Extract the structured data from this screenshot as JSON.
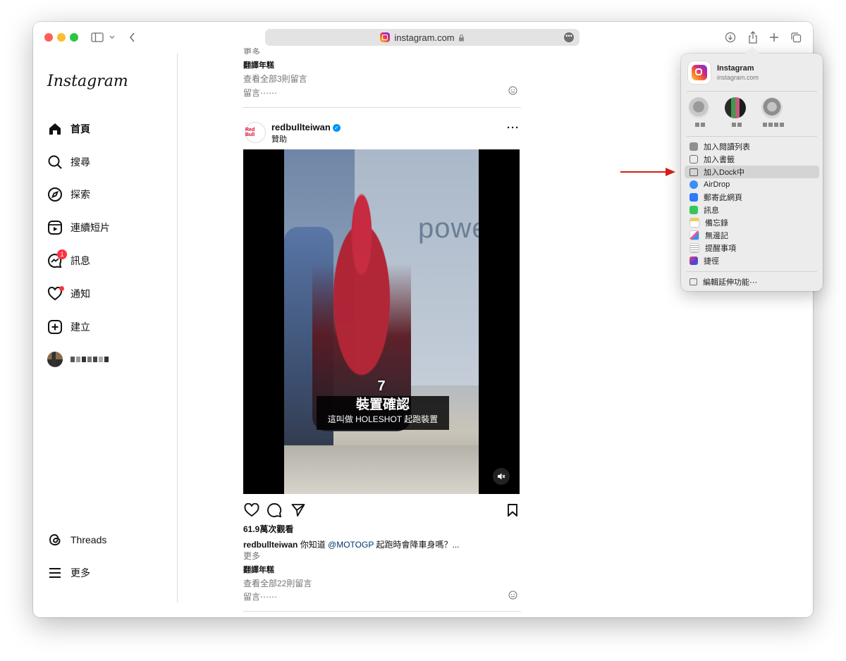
{
  "browser": {
    "url": "instagram.com"
  },
  "sidebar": {
    "logo": "Instagram",
    "items": [
      {
        "label": "首頁",
        "icon": "home-icon"
      },
      {
        "label": "搜尋",
        "icon": "search-icon"
      },
      {
        "label": "探索",
        "icon": "compass-icon"
      },
      {
        "label": "連續短片",
        "icon": "reels-icon"
      },
      {
        "label": "訊息",
        "icon": "messenger-icon",
        "badge": "1"
      },
      {
        "label": "通知",
        "icon": "heart-icon"
      },
      {
        "label": "建立",
        "icon": "plus-square-icon"
      },
      {
        "label": "Threads",
        "icon": "threads-icon"
      },
      {
        "label": "更多",
        "icon": "menu-icon"
      }
    ]
  },
  "feed": {
    "prev_post": {
      "more": "更多",
      "translate": "翻譯年糕",
      "view_comments": "查看全部3則留言",
      "comment_placeholder": "留言⋯⋯"
    },
    "post": {
      "username": "redbullteiwan",
      "sponsored": "贊助",
      "avatar_text": "Red Bull",
      "video_caption_number": "7",
      "video_caption_title": "裝置確認",
      "video_caption_sub": "這叫做 HOLESHOT 起跑裝置",
      "wall_text": "powe",
      "views": "61.9萬次觀看",
      "caption_user": "redbullteiwan",
      "caption_text_a": "你知道",
      "caption_mention": "@MOTOGP",
      "caption_text_b": "起跑時會降車身嗎？...",
      "more": "更多",
      "translate": "翻譯年糕",
      "view_comments": "查看全部22則留言",
      "comment_placeholder": "留言⋯⋯",
      "more_options": "···"
    }
  },
  "share_menu": {
    "app_name": "Instagram",
    "app_url": "instagram.com",
    "items": [
      {
        "label": "加入閱讀列表",
        "color": "#8e8e93"
      },
      {
        "label": "加入書籤",
        "color": "#8e8e93"
      },
      {
        "label": "加入Dock中",
        "color": "#6e6e73"
      },
      {
        "label": "AirDrop",
        "color": "#3a8ef6"
      },
      {
        "label": "郵寄此網頁",
        "color": "#2b7cf6"
      },
      {
        "label": "訊息",
        "color": "#34c759"
      },
      {
        "label": "備忘錄",
        "color": "#f7cf46"
      },
      {
        "label": "無邊記",
        "color": "#e45a8c"
      },
      {
        "label": "提醒事項",
        "color": "#e9e9ee"
      },
      {
        "label": "捷徑",
        "color": "#5b3fcf"
      }
    ],
    "extensions": "編輯延伸功能⋯"
  },
  "colors": {
    "annotation_arrow": "#d0201b",
    "instagram_link": "#00376b"
  }
}
